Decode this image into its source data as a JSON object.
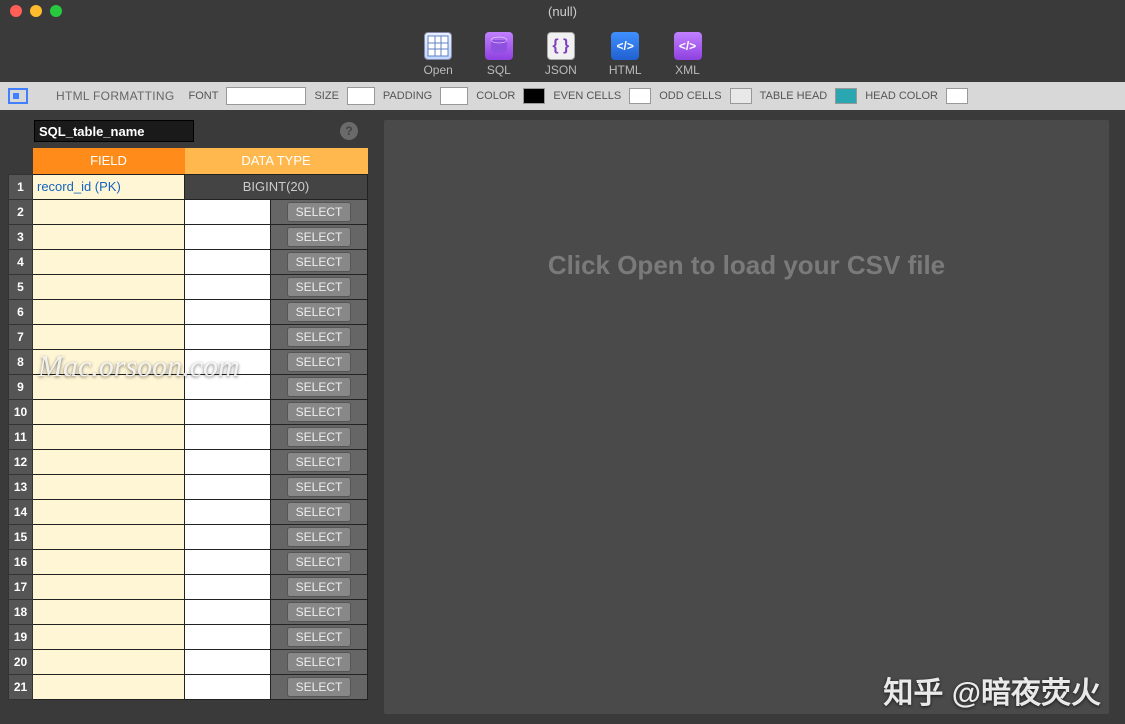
{
  "window": {
    "title": "(null)"
  },
  "toolbar": {
    "open": "Open",
    "sql": "SQL",
    "json": "JSON",
    "html": "HTML",
    "xml": "XML"
  },
  "format_bar": {
    "heading": "HTML FORMATTING",
    "font_label": "FONT",
    "font_value": "",
    "size_label": "SIZE",
    "size_value": "",
    "padding_label": "PADDING",
    "padding_value": "",
    "color_label": "COLOR",
    "color_value": "#000000",
    "even_label": "EVEN CELLS",
    "even_value": "#ffffff",
    "odd_label": "ODD CELLS",
    "odd_value": "#e8e8e8",
    "tablehead_label": "TABLE HEAD",
    "tablehead_value": "#2aa6b0",
    "headcolor_label": "HEAD COLOR",
    "headcolor_value": "#ffffff"
  },
  "schema": {
    "table_name": "SQL_table_name",
    "field_header": "FIELD",
    "datatype_header": "DATA TYPE",
    "select_label": "SELECT",
    "row_count": 21,
    "first_field": "record_id (PK)",
    "first_type": "BIGINT(20)"
  },
  "preview": {
    "placeholder": "Click Open to load your CSV file"
  },
  "watermark1": "Mac.orsoon.com",
  "watermark2": "知乎 @暗夜荧火"
}
